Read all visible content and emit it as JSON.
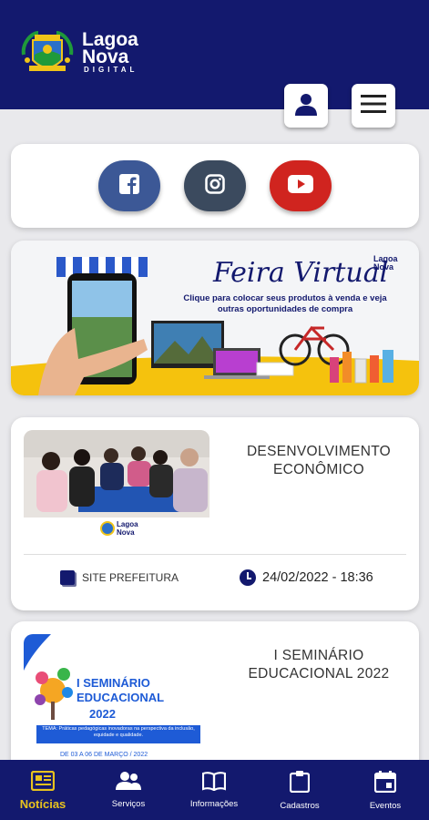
{
  "header": {
    "logo_line1": "Lagoa",
    "logo_line2": "Nova",
    "logo_line3": "DIGITAL",
    "user_icon": "user-icon",
    "menu_icon": "hamburger-icon"
  },
  "social": {
    "facebook_icon": "facebook-icon",
    "instagram_icon": "instagram-icon",
    "youtube_icon": "youtube-icon"
  },
  "banner": {
    "title": "Feira Virtual",
    "subtitle": "Clique para colocar seus produtos à venda e veja outras oportunidades de compra",
    "logo_line1": "Lagoa",
    "logo_line2": "Nova"
  },
  "news": [
    {
      "title": "DESENVOLVIMENTO ECONÔMICO",
      "image_caption_1": "Lagoa",
      "image_caption_2": "Nova",
      "source": "SITE PREFEITURA",
      "datetime": "24/02/2022 - 18:36"
    },
    {
      "title": "I SEMINÁRIO EDUCACIONAL 2022",
      "image_title_1": "I SEMINÁRIO",
      "image_title_2": "EDUCACIONAL",
      "image_title_3": "2022",
      "image_theme": "TEMA: Práticas pedagógicas inovadoras na perspectiva da inclusão, equidade e qualidade.",
      "image_date": "DE 03 A 06 DE MARÇO / 2022"
    }
  ],
  "bottom_nav": [
    {
      "label": "Notícias",
      "icon": "newspaper-icon",
      "active": true
    },
    {
      "label": "Serviços",
      "icon": "people-icon",
      "active": false
    },
    {
      "label": "Informações",
      "icon": "book-icon",
      "active": false
    },
    {
      "label": "Cadastros",
      "icon": "clipboard-icon",
      "active": false
    },
    {
      "label": "Eventos",
      "icon": "calendar-icon",
      "active": false
    }
  ],
  "colors": {
    "primary": "#13196e",
    "accent": "#e8c21e",
    "facebook": "#3c5896",
    "instagram": "#3b4a5e",
    "youtube": "#d0241f"
  }
}
